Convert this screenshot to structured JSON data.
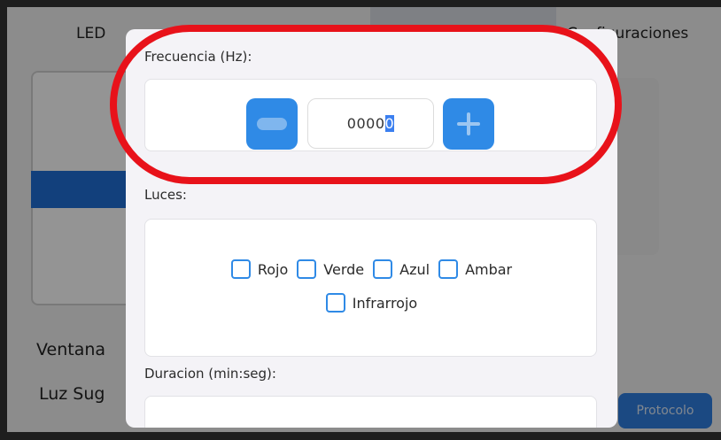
{
  "tabs": {
    "led_label": "LED",
    "config_label": "Configuraciones"
  },
  "background": {
    "ventana_label": "Ventana",
    "luz_label": "Luz Sug",
    "protocolo_label": "Protocolo"
  },
  "modal": {
    "frecuencia": {
      "label": "Frecuencia (Hz):",
      "value_prefix": "0000",
      "value_selected": "0",
      "minus_icon": "minus-icon",
      "plus_icon": "plus-icon"
    },
    "luces": {
      "label": "Luces:",
      "options": [
        "Rojo",
        "Verde",
        "Azul",
        "Ambar",
        "Infrarrojo"
      ]
    },
    "duracion": {
      "label": "Duracion (min:seg):"
    }
  },
  "colors": {
    "accent": "#2f8ae6",
    "annotation": "#e8121a",
    "modal_bg": "#f4f3f7"
  }
}
